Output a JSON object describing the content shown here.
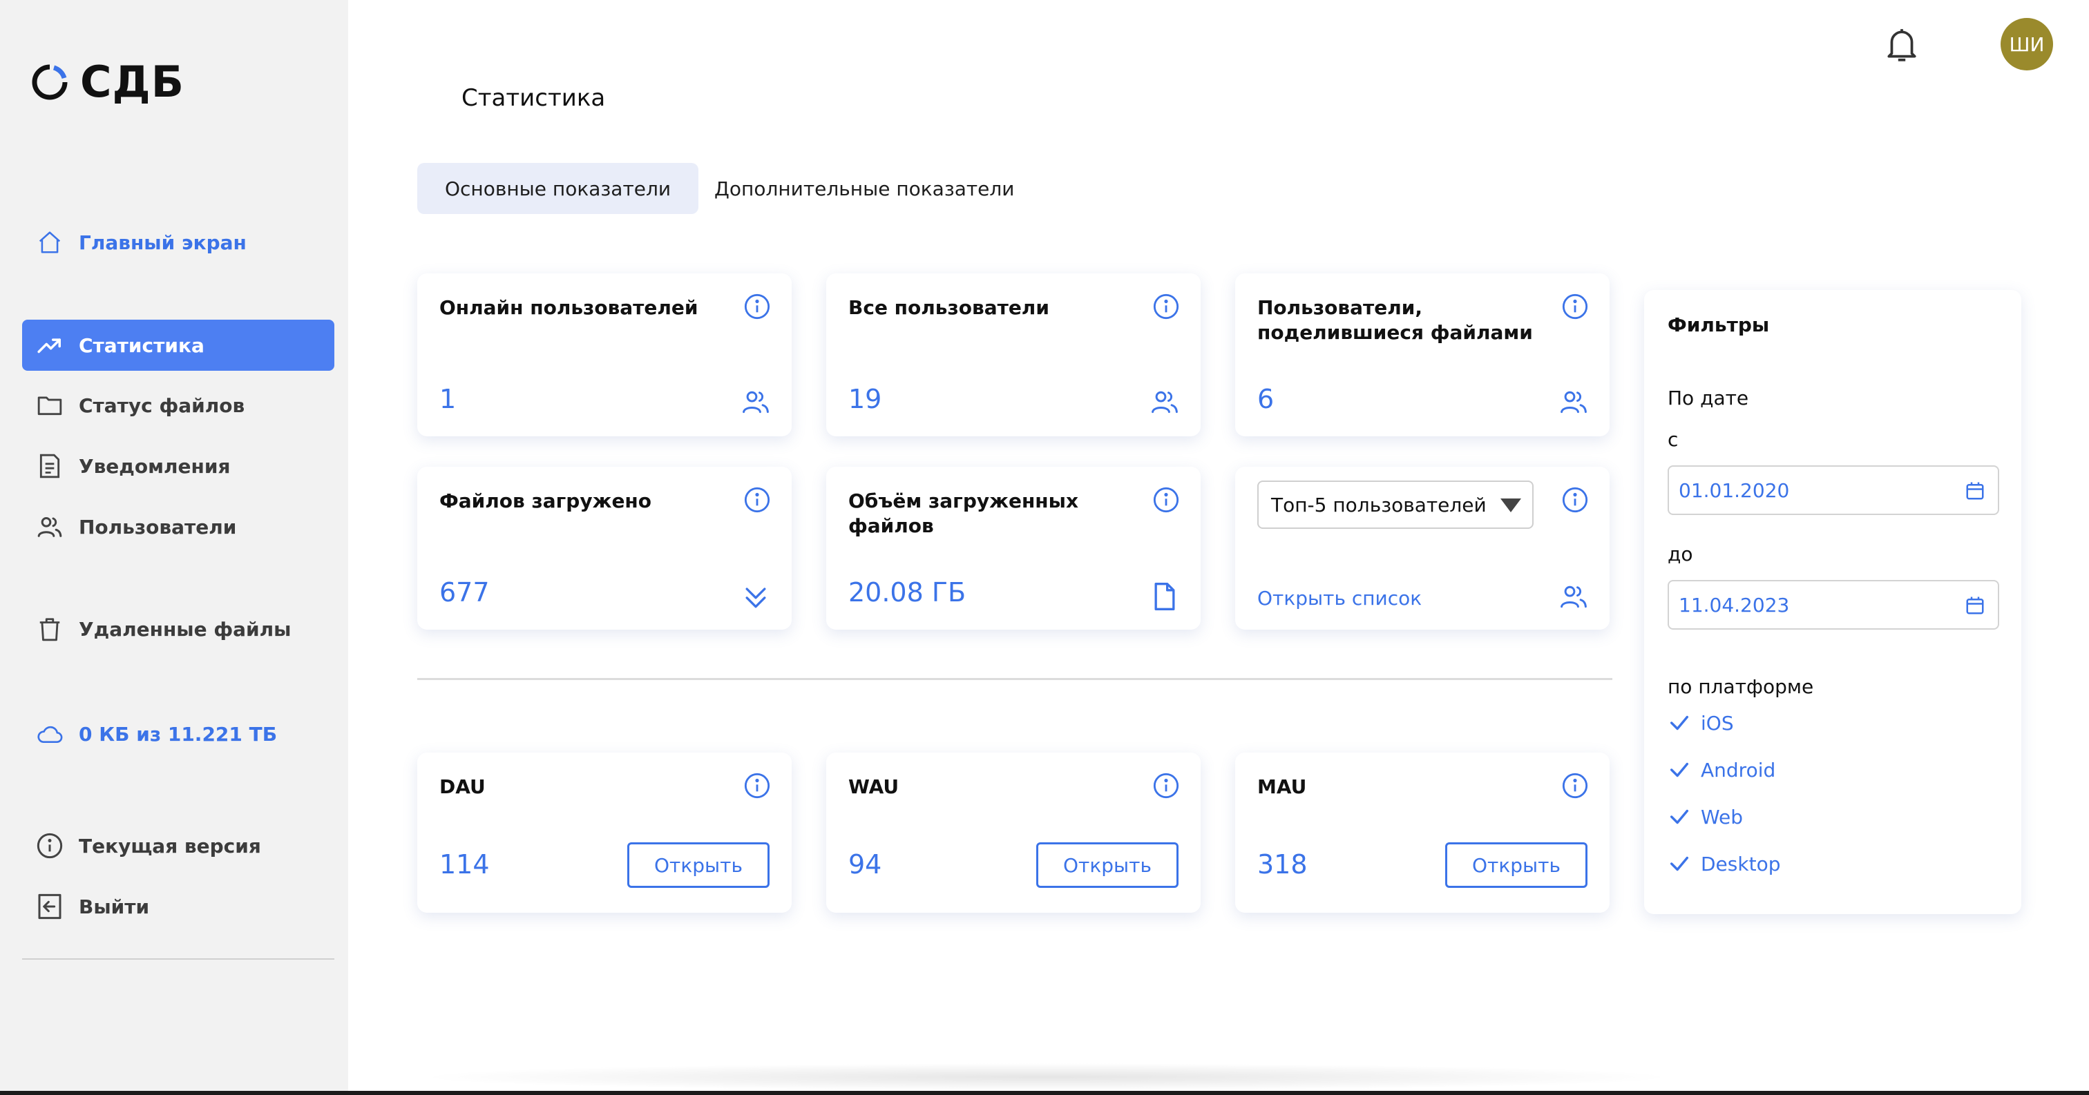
{
  "app": {
    "logo_text": "СДБ"
  },
  "sidebar": {
    "items": [
      {
        "label": "Главный экран",
        "icon": "home-icon"
      },
      {
        "label": "Статистика",
        "icon": "trending-up-icon"
      },
      {
        "label": "Статус файлов",
        "icon": "folder-icon"
      },
      {
        "label": "Уведомления",
        "icon": "document-icon"
      },
      {
        "label": "Пользователи",
        "icon": "users-icon"
      },
      {
        "label": "Удаленные файлы",
        "icon": "trash-icon"
      },
      {
        "label": "0 КБ из 11.221 ТБ",
        "icon": "cloud-icon"
      },
      {
        "label": "Текущая версия",
        "icon": "info-icon"
      },
      {
        "label": "Выйти",
        "icon": "logout-icon"
      }
    ]
  },
  "header": {
    "avatar_initials": "ШИ",
    "notifications_icon": "bell-icon"
  },
  "page": {
    "title": "Статистика"
  },
  "tabs": [
    {
      "label": "Основные показатели",
      "active": true
    },
    {
      "label": "Дополнительные показатели",
      "active": false
    }
  ],
  "cards": {
    "online": {
      "title": "Онлайн пользователей",
      "value": "1",
      "icon": "users-icon"
    },
    "all_users": {
      "title": "Все пользователи",
      "value": "19",
      "icon": "users-icon"
    },
    "shared": {
      "title": "Пользователи, поделившиеся файлами",
      "value": "6",
      "icon": "users-icon"
    },
    "uploaded": {
      "title": "Файлов загружено",
      "value": "677",
      "icon": "double-chevron-down-icon"
    },
    "volume": {
      "title": "Объём загруженных файлов",
      "value": "20.08 ГБ",
      "icon": "file-icon"
    },
    "top5": {
      "select_value": "Топ-5 пользователей",
      "link": "Открыть список",
      "icon": "users-icon"
    },
    "dau": {
      "title": "DAU",
      "value": "114",
      "button": "Открыть"
    },
    "wau": {
      "title": "WAU",
      "value": "94",
      "button": "Открыть"
    },
    "mau": {
      "title": "MAU",
      "value": "318",
      "button": "Открыть"
    }
  },
  "filters": {
    "title": "Фильтры",
    "by_date": "По дате",
    "from_label": "с",
    "from_value": "01.01.2020",
    "to_label": "до",
    "to_value": "11.04.2023",
    "by_platform": "по платформе",
    "platforms": [
      "iOS",
      "Android",
      "Web",
      "Desktop"
    ]
  },
  "colors": {
    "accent": "#3b73e8",
    "active_nav": "#4d7ff2",
    "sidebar_bg": "#f2f2f2",
    "avatar_bg": "#9a8a2c"
  }
}
